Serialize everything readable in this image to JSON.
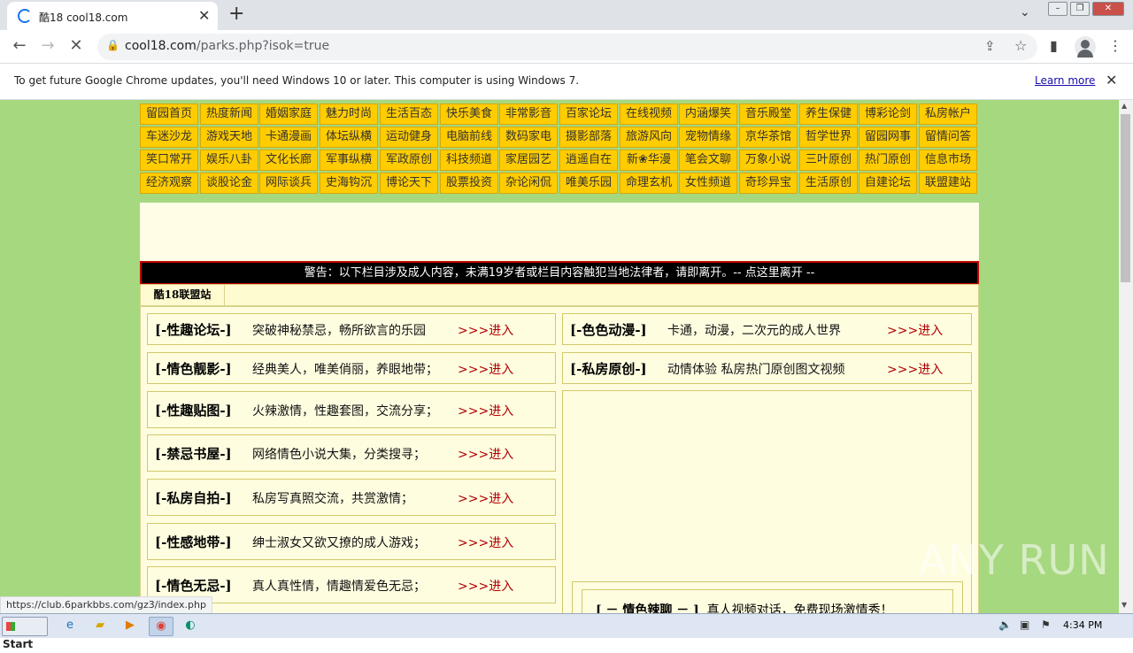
{
  "browser": {
    "tab_title": "酷18 cool18.com",
    "url_host": "cool18.com",
    "url_path": "/parks.php?isok=true",
    "infobar_message": "To get future Google Chrome updates, you'll need Windows 10 or later. This computer is using Windows 7.",
    "infobar_link": "Learn more",
    "status_url": "https://club.6parkbbs.com/gz3/index.php"
  },
  "nav": {
    "rows": [
      [
        "留园首页",
        "热度新闻",
        "婚姻家庭",
        "魅力时尚",
        "生活百态",
        "快乐美食",
        "非常影音",
        "百家论坛",
        "在线视频",
        "内涵爆笑",
        "音乐殿堂",
        "养生保健",
        "博彩论剑",
        "私房帐户"
      ],
      [
        "车迷沙龙",
        "游戏天地",
        "卡通漫画",
        "体坛纵横",
        "运动健身",
        "电脑前线",
        "数码家电",
        "摄影部落",
        "旅游风向",
        "宠物情缘",
        "京华茶馆",
        "哲学世界",
        "留园网事",
        "留情问答"
      ],
      [
        "笑口常开",
        "娱乐八卦",
        "文化长廊",
        "军事纵横",
        "军政原创",
        "科技频道",
        "家居园艺",
        "逍遥自在",
        "新❀华漫",
        "笔会文聊",
        "万象小说",
        "三叶原创",
        "热门原创",
        "信息市场"
      ],
      [
        "经济观察",
        "谈股论金",
        "网际谈兵",
        "史海钩沉",
        "博论天下",
        "股票投资",
        "杂论闲侃",
        "唯美乐园",
        "命理玄机",
        "女性频道",
        "奇珍异宝",
        "生活原创",
        "自建论坛",
        "联盟建站"
      ]
    ]
  },
  "warning": "警告：以下栏目涉及成人内容，未满19岁者或栏目内容触犯当地法律者，请即离开。-- 点这里离开 --",
  "site_label": "酷18联盟站",
  "enter_label": ">>>进入",
  "left_sections": [
    {
      "name": "[-性趣论坛-]",
      "desc": "突破神秘禁忌，畅所欲言的乐园"
    },
    {
      "name": "[-情色靓影-]",
      "desc": "经典美人，唯美俏丽，养眼地带；"
    },
    {
      "name": "[-性趣贴图-]",
      "desc": "火辣激情，性趣套图，交流分享；"
    },
    {
      "name": "[-禁忌书屋-]",
      "desc": "网络情色小说大集，分类搜寻；"
    },
    {
      "name": "[-私房自拍-]",
      "desc": "私房写真照交流，共赏激情；"
    },
    {
      "name": "[-性感地带-]",
      "desc": "绅士淑女又欲又撩的成人游戏；"
    },
    {
      "name": "[-情色无忌-]",
      "desc": "真人真性情，情趣情爱色无忌；"
    }
  ],
  "right_sections": [
    {
      "name": "[-色色动漫-]",
      "desc": "卡通，动漫，二次元的成人世界"
    },
    {
      "name": "[-私房原创-]",
      "desc": "动情体验 私房热门原创图文视频"
    }
  ],
  "right_inner": {
    "name": "[ － 情色辣聊 － ]",
    "desc": "真人视频对话，免费现场激情秀！"
  },
  "watermark": "ANY RUN",
  "taskbar": {
    "start": "Start",
    "clock": "4:34 PM"
  }
}
